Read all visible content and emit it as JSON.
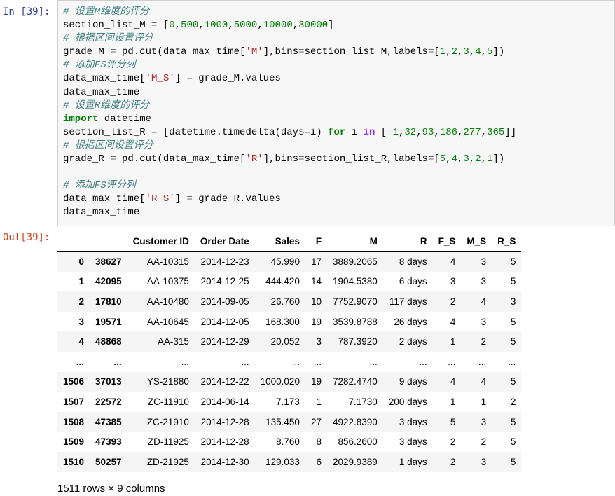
{
  "in_prompt": "In  [39]:",
  "out_prompt": "Out[39]:",
  "code_lines": [
    [
      {
        "t": "# 设置M维度的评分",
        "c": "c-comment"
      }
    ],
    [
      {
        "t": "section_list_M "
      },
      {
        "t": "=",
        "c": "c-eq"
      },
      {
        "t": " ["
      },
      {
        "t": "0",
        "c": "c-num"
      },
      {
        "t": ","
      },
      {
        "t": "500",
        "c": "c-num"
      },
      {
        "t": ","
      },
      {
        "t": "1000",
        "c": "c-num"
      },
      {
        "t": ","
      },
      {
        "t": "5000",
        "c": "c-num"
      },
      {
        "t": ","
      },
      {
        "t": "10000",
        "c": "c-num"
      },
      {
        "t": ","
      },
      {
        "t": "30000",
        "c": "c-num"
      },
      {
        "t": "]"
      }
    ],
    [
      {
        "t": "# 根据区间设置评分",
        "c": "c-comment"
      }
    ],
    [
      {
        "t": "grade_M "
      },
      {
        "t": "=",
        "c": "c-eq"
      },
      {
        "t": " pd.cut(data_max_time["
      },
      {
        "t": "'M'",
        "c": "c-str"
      },
      {
        "t": "],bins"
      },
      {
        "t": "=",
        "c": "c-eq"
      },
      {
        "t": "section_list_M,labels"
      },
      {
        "t": "=",
        "c": "c-eq"
      },
      {
        "t": "["
      },
      {
        "t": "1",
        "c": "c-num"
      },
      {
        "t": ","
      },
      {
        "t": "2",
        "c": "c-num"
      },
      {
        "t": ","
      },
      {
        "t": "3",
        "c": "c-num"
      },
      {
        "t": ","
      },
      {
        "t": "4",
        "c": "c-num"
      },
      {
        "t": ","
      },
      {
        "t": "5",
        "c": "c-num"
      },
      {
        "t": "])"
      }
    ],
    [
      {
        "t": "# 添加FS评分列",
        "c": "c-comment"
      }
    ],
    [
      {
        "t": "data_max_time["
      },
      {
        "t": "'M_S'",
        "c": "c-str"
      },
      {
        "t": "] "
      },
      {
        "t": "=",
        "c": "c-eq"
      },
      {
        "t": " grade_M.values"
      }
    ],
    [
      {
        "t": "data_max_time"
      }
    ],
    [
      {
        "t": "# 设置R维度的评分",
        "c": "c-comment"
      }
    ],
    [
      {
        "t": "import",
        "c": "c-kw"
      },
      {
        "t": " datetime"
      }
    ],
    [
      {
        "t": "section_list_R "
      },
      {
        "t": "=",
        "c": "c-eq"
      },
      {
        "t": " [datetime.timedelta(days"
      },
      {
        "t": "=",
        "c": "c-eq"
      },
      {
        "t": "i) "
      },
      {
        "t": "for",
        "c": "c-kw"
      },
      {
        "t": " i "
      },
      {
        "t": "in",
        "c": "c-op"
      },
      {
        "t": " ["
      },
      {
        "t": "-",
        "c": "c-eq"
      },
      {
        "t": "1",
        "c": "c-num"
      },
      {
        "t": ","
      },
      {
        "t": "32",
        "c": "c-num"
      },
      {
        "t": ","
      },
      {
        "t": "93",
        "c": "c-num"
      },
      {
        "t": ","
      },
      {
        "t": "186",
        "c": "c-num"
      },
      {
        "t": ","
      },
      {
        "t": "277",
        "c": "c-num"
      },
      {
        "t": ","
      },
      {
        "t": "365",
        "c": "c-num"
      },
      {
        "t": "]]"
      }
    ],
    [
      {
        "t": "# 根据区间设置评分",
        "c": "c-comment"
      }
    ],
    [
      {
        "t": "grade_R "
      },
      {
        "t": "=",
        "c": "c-eq"
      },
      {
        "t": " pd.cut(data_max_time["
      },
      {
        "t": "'R'",
        "c": "c-str"
      },
      {
        "t": "],bins"
      },
      {
        "t": "=",
        "c": "c-eq"
      },
      {
        "t": "section_list_R,labels"
      },
      {
        "t": "=",
        "c": "c-eq"
      },
      {
        "t": "["
      },
      {
        "t": "5",
        "c": "c-num"
      },
      {
        "t": ","
      },
      {
        "t": "4",
        "c": "c-num"
      },
      {
        "t": ","
      },
      {
        "t": "3",
        "c": "c-num"
      },
      {
        "t": ","
      },
      {
        "t": "2",
        "c": "c-num"
      },
      {
        "t": ","
      },
      {
        "t": "1",
        "c": "c-num"
      },
      {
        "t": "])"
      }
    ],
    [],
    [
      {
        "t": "# 添加FS评分列",
        "c": "c-comment"
      }
    ],
    [
      {
        "t": "data_max_time["
      },
      {
        "t": "'R_S'",
        "c": "c-str"
      },
      {
        "t": "] "
      },
      {
        "t": "=",
        "c": "c-eq"
      },
      {
        "t": " grade_R.values"
      }
    ],
    [
      {
        "t": "data_max_time"
      }
    ]
  ],
  "table": {
    "columns": [
      "",
      "",
      "Customer ID",
      "Order Date",
      "Sales",
      "F",
      "M",
      "R",
      "F_S",
      "M_S",
      "R_S"
    ],
    "rows": [
      [
        "0",
        "38627",
        "AA-10315",
        "2014-12-23",
        "45.990",
        "17",
        "3889.2065",
        "8 days",
        "4",
        "3",
        "5"
      ],
      [
        "1",
        "42095",
        "AA-10375",
        "2014-12-25",
        "444.420",
        "14",
        "1904.5380",
        "6 days",
        "3",
        "3",
        "5"
      ],
      [
        "2",
        "17810",
        "AA-10480",
        "2014-09-05",
        "26.760",
        "10",
        "7752.9070",
        "117 days",
        "2",
        "4",
        "3"
      ],
      [
        "3",
        "19571",
        "AA-10645",
        "2014-12-05",
        "168.300",
        "19",
        "3539.8788",
        "26 days",
        "4",
        "3",
        "5"
      ],
      [
        "4",
        "48868",
        "AA-315",
        "2014-12-29",
        "20.052",
        "3",
        "787.3920",
        "2 days",
        "1",
        "2",
        "5"
      ],
      [
        "...",
        "...",
        "...",
        "...",
        "...",
        "...",
        "...",
        "...",
        "...",
        "...",
        "..."
      ],
      [
        "1506",
        "37013",
        "YS-21880",
        "2014-12-22",
        "1000.020",
        "19",
        "7282.4740",
        "9 days",
        "4",
        "4",
        "5"
      ],
      [
        "1507",
        "22572",
        "ZC-11910",
        "2014-06-14",
        "7.173",
        "1",
        "7.1730",
        "200 days",
        "1",
        "1",
        "2"
      ],
      [
        "1508",
        "47385",
        "ZC-21910",
        "2014-12-28",
        "135.450",
        "27",
        "4922.8390",
        "3 days",
        "5",
        "3",
        "5"
      ],
      [
        "1509",
        "47393",
        "ZD-11925",
        "2014-12-28",
        "8.760",
        "8",
        "856.2600",
        "3 days",
        "2",
        "2",
        "5"
      ],
      [
        "1510",
        "50257",
        "ZD-21925",
        "2014-12-30",
        "129.033",
        "6",
        "2029.9389",
        "1 days",
        "2",
        "3",
        "5"
      ]
    ]
  },
  "summary": "1511 rows × 9 columns"
}
